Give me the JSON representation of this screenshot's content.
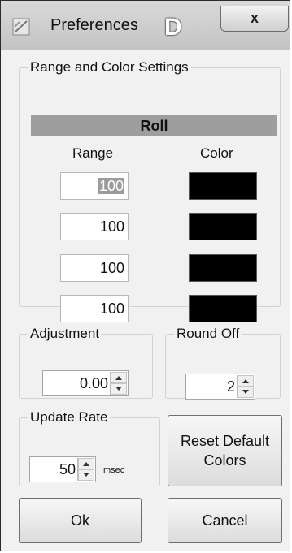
{
  "window": {
    "title": "Preferences",
    "badge": "D",
    "close_label": "x"
  },
  "range_color": {
    "legend": "Range and Color Settings",
    "section_label": "Roll",
    "range_header": "Range",
    "color_header": "Color",
    "rows": [
      {
        "range": "100",
        "color": "#000000"
      },
      {
        "range": "100",
        "color": "#000000"
      },
      {
        "range": "100",
        "color": "#000000"
      },
      {
        "range": "100",
        "color": "#000000"
      }
    ]
  },
  "adjustment": {
    "legend": "Adjustment",
    "value": "0.00"
  },
  "round_off": {
    "legend": "Round Off",
    "value": "2"
  },
  "update_rate": {
    "legend": "Update Rate",
    "value": "50",
    "unit": "msec"
  },
  "buttons": {
    "reset_line1": "Reset Default",
    "reset_line2": "Colors",
    "ok": "Ok",
    "cancel": "Cancel"
  }
}
